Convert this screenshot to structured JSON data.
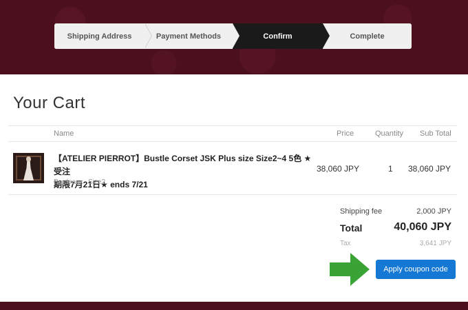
{
  "checkout_steps": [
    {
      "label": "Shipping Address",
      "active": false
    },
    {
      "label": "Payment Methods",
      "active": false
    },
    {
      "label": "Confirm",
      "active": true
    },
    {
      "label": "Complete",
      "active": false
    }
  ],
  "cart": {
    "title": "Your Cart",
    "columns": {
      "name": "Name",
      "price": "Price",
      "quantity": "Quantity",
      "subtotal": "Sub Total"
    },
    "items": [
      {
        "name_line1": "【ATELIER PIERROT】Bustle Corset JSK Plus size Size2~4 5色 ★受注",
        "name_line2": "期限7月21日★ ends 7/21",
        "color": "Bordeaux",
        "size": "Size2",
        "price": "38,060 JPY",
        "quantity": "1",
        "subtotal": "38,060 JPY"
      }
    ]
  },
  "summary": {
    "shipping_label": "Shipping fee",
    "shipping_value": "2,000 JPY",
    "total_label": "Total",
    "total_value": "40,060 JPY",
    "tax_label": "Tax",
    "tax_value": "3,641 JPY"
  },
  "coupon_button_label": "Apply coupon code",
  "colors": {
    "banner": "#4b0f1d",
    "active_step": "#1a1a1a",
    "button": "#1478d4",
    "arrow": "#3aa335"
  },
  "icons": {
    "product_thumbnail": "dress-photo",
    "pointer": "green-arrow-right"
  }
}
